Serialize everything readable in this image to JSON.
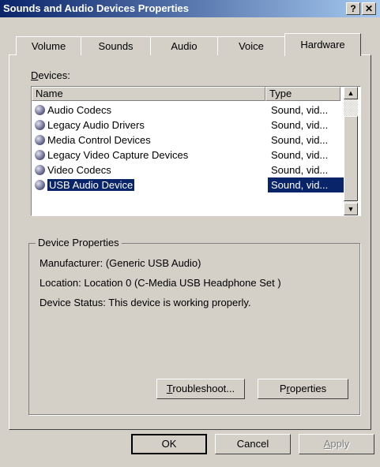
{
  "window": {
    "title": "Sounds and Audio Devices Properties",
    "help_btn": "?",
    "close_btn": "✕"
  },
  "tabs": [
    {
      "label": "Volume"
    },
    {
      "label": "Sounds"
    },
    {
      "label": "Audio"
    },
    {
      "label": "Voice"
    },
    {
      "label": "Hardware"
    }
  ],
  "devices": {
    "label_accel": "D",
    "label_rest": "evices:",
    "col_name": "Name",
    "col_type": "Type",
    "rows": [
      {
        "name": "Audio Codecs",
        "type": "Sound, vid..."
      },
      {
        "name": "Legacy Audio Drivers",
        "type": "Sound, vid..."
      },
      {
        "name": "Media Control Devices",
        "type": "Sound, vid..."
      },
      {
        "name": "Legacy Video Capture Devices",
        "type": "Sound, vid..."
      },
      {
        "name": "Video Codecs",
        "type": "Sound, vid..."
      },
      {
        "name": "USB Audio Device",
        "type": "Sound, vid..."
      }
    ],
    "selected_index": 5
  },
  "device_properties": {
    "group_label": "Device Properties",
    "manufacturer": "Manufacturer: (Generic USB Audio)",
    "location": "Location: Location 0 (C-Media USB Headphone Set  )",
    "status": "Device Status: This device is working properly.",
    "troubleshoot_accel": "T",
    "troubleshoot_rest": "roubleshoot...",
    "properties_pre": "P",
    "properties_accel": "r",
    "properties_rest": "operties"
  },
  "footer": {
    "ok": "OK",
    "cancel": "Cancel",
    "apply_accel": "A",
    "apply_rest": "pply"
  }
}
